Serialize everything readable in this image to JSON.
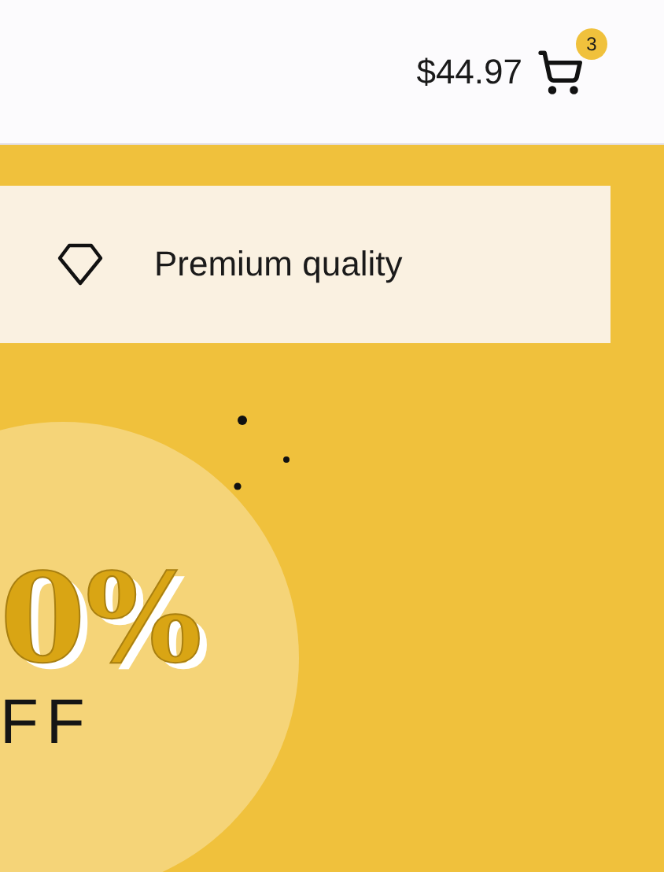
{
  "header": {
    "cart_total": "$44.97",
    "cart_count": "3"
  },
  "feature": {
    "label": "Premium quality"
  },
  "promo": {
    "discount": "0%",
    "suffix": "FF"
  }
}
